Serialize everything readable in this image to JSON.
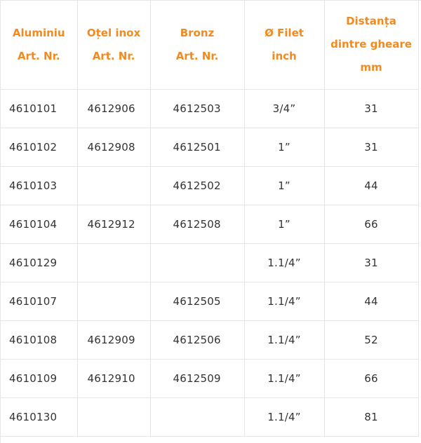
{
  "table": {
    "headers": [
      [
        "Aluminiu",
        "Art. Nr."
      ],
      [
        "Oțel inox",
        "Art. Nr."
      ],
      [
        "Bronz",
        "Art. Nr."
      ],
      [
        "Ø Filet",
        "inch"
      ],
      [
        "Distanța",
        "dintre gheare",
        "mm"
      ]
    ],
    "rows": [
      [
        "4610101",
        "4612906",
        "4612503",
        "3/4”",
        "31"
      ],
      [
        "4610102",
        "4612908",
        "4612501",
        "1”",
        "31"
      ],
      [
        "4610103",
        "",
        "4612502",
        "1”",
        "44"
      ],
      [
        "4610104",
        "4612912",
        "4612508",
        "1”",
        "66"
      ],
      [
        "4610129",
        "",
        "",
        "1.1/4”",
        "31"
      ],
      [
        "4610107",
        "",
        "4612505",
        "1.1/4”",
        "44"
      ],
      [
        "4610108",
        "4612909",
        "4612506",
        "1.1/4”",
        "52"
      ],
      [
        "4610109",
        "4612910",
        "4612509",
        "1.1/4”",
        "66"
      ],
      [
        "4610130",
        "",
        "",
        "1.1/4”",
        "81"
      ]
    ]
  },
  "colors": {
    "header_text": "#f28a1f",
    "body_text": "#333333",
    "grid": "#e6e6e6"
  }
}
